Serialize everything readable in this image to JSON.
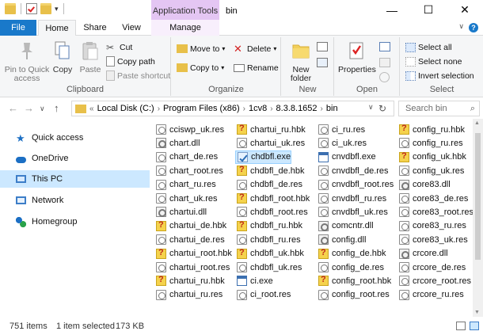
{
  "window": {
    "title": "bin",
    "context_tab": "Application Tools",
    "controls": {
      "minimize": "—",
      "maximize": "☐",
      "close": "✕"
    }
  },
  "ribbon_tabs": [
    "File",
    "Home",
    "Share",
    "View",
    "Manage"
  ],
  "ribbon": {
    "clipboard": {
      "label": "Clipboard",
      "pin": "Pin to Quick access",
      "copy": "Copy",
      "paste": "Paste",
      "cut": "Cut",
      "copy_path": "Copy path",
      "paste_shortcut": "Paste shortcut"
    },
    "organize": {
      "label": "Organize",
      "move_to": "Move to",
      "copy_to": "Copy to",
      "delete": "Delete",
      "rename": "Rename"
    },
    "new": {
      "label": "New",
      "new_folder": "New folder"
    },
    "open": {
      "label": "Open",
      "properties": "Properties"
    },
    "select": {
      "label": "Select",
      "select_all": "Select all",
      "select_none": "Select none",
      "invert_selection": "Invert selection"
    }
  },
  "address": {
    "crumbs": [
      "Local Disk (C:)",
      "Program Files (x86)",
      "1cv8",
      "8.3.8.1652",
      "bin"
    ],
    "search_placeholder": "Search bin"
  },
  "nav": [
    {
      "label": "Quick access",
      "icon": "star-icon",
      "selected": false
    },
    {
      "label": "OneDrive",
      "icon": "cloud-icon",
      "selected": false
    },
    {
      "label": "This PC",
      "icon": "computer-icon",
      "selected": true
    },
    {
      "label": "Network",
      "icon": "network-icon",
      "selected": false
    },
    {
      "label": "Homegroup",
      "icon": "homegroup-icon",
      "selected": false
    }
  ],
  "files": {
    "columns": [
      [
        {
          "name": "cciswp_uk.res",
          "type": "res"
        },
        {
          "name": "chart.dll",
          "type": "dll"
        },
        {
          "name": "chart_de.res",
          "type": "res"
        },
        {
          "name": "chart_root.res",
          "type": "res"
        },
        {
          "name": "chart_ru.res",
          "type": "res"
        },
        {
          "name": "chart_uk.res",
          "type": "res"
        },
        {
          "name": "chartui.dll",
          "type": "dll"
        },
        {
          "name": "chartui_de.hbk",
          "type": "hbk"
        },
        {
          "name": "chartui_de.res",
          "type": "res"
        },
        {
          "name": "chartui_root.hbk",
          "type": "hbk"
        },
        {
          "name": "chartui_root.res",
          "type": "res"
        },
        {
          "name": "chartui_ru.hbk",
          "type": "hbk"
        },
        {
          "name": "chartui_ru.res",
          "type": "res"
        }
      ],
      [
        {
          "name": "chartui_ru.hbk",
          "type": "hbk"
        },
        {
          "name": "chartui_uk.res",
          "type": "res"
        },
        {
          "name": "chdbfl.exe",
          "type": "exe-ch",
          "selected": true
        },
        {
          "name": "chdbfl_de.hbk",
          "type": "hbk"
        },
        {
          "name": "chdbfl_de.res",
          "type": "res"
        },
        {
          "name": "chdbfl_root.hbk",
          "type": "hbk"
        },
        {
          "name": "chdbfl_root.res",
          "type": "res"
        },
        {
          "name": "chdbfl_ru.hbk",
          "type": "hbk"
        },
        {
          "name": "chdbfl_ru.res",
          "type": "res"
        },
        {
          "name": "chdbfl_uk.hbk",
          "type": "hbk"
        },
        {
          "name": "chdbfl_uk.res",
          "type": "res"
        },
        {
          "name": "ci.exe",
          "type": "exe"
        },
        {
          "name": "ci_root.res",
          "type": "res"
        }
      ],
      [
        {
          "name": "ci_ru.res",
          "type": "res"
        },
        {
          "name": "ci_uk.res",
          "type": "res"
        },
        {
          "name": "cnvdbfl.exe",
          "type": "exe"
        },
        {
          "name": "cnvdbfl_de.res",
          "type": "res"
        },
        {
          "name": "cnvdbfl_root.res",
          "type": "res"
        },
        {
          "name": "cnvdbfl_ru.res",
          "type": "res"
        },
        {
          "name": "cnvdbfl_uk.res",
          "type": "res"
        },
        {
          "name": "comcntr.dll",
          "type": "dll"
        },
        {
          "name": "config.dll",
          "type": "dll"
        },
        {
          "name": "config_de.hbk",
          "type": "hbk"
        },
        {
          "name": "config_de.res",
          "type": "res"
        },
        {
          "name": "config_root.hbk",
          "type": "hbk"
        },
        {
          "name": "config_root.res",
          "type": "res"
        }
      ],
      [
        {
          "name": "config_ru.hbk",
          "type": "hbk"
        },
        {
          "name": "config_ru.res",
          "type": "res"
        },
        {
          "name": "config_uk.hbk",
          "type": "hbk"
        },
        {
          "name": "config_uk.res",
          "type": "res"
        },
        {
          "name": "core83.dll",
          "type": "dll"
        },
        {
          "name": "core83_de.res",
          "type": "res"
        },
        {
          "name": "core83_root.res",
          "type": "res"
        },
        {
          "name": "core83_ru.res",
          "type": "res"
        },
        {
          "name": "core83_uk.res",
          "type": "res"
        },
        {
          "name": "crcore.dll",
          "type": "dll"
        },
        {
          "name": "crcore_de.res",
          "type": "res"
        },
        {
          "name": "crcore_root.res",
          "type": "res"
        },
        {
          "name": "crcore_ru.res",
          "type": "res"
        }
      ]
    ]
  },
  "status": {
    "count": "751 items",
    "selection": "1 item selected",
    "size": "173 KB"
  }
}
